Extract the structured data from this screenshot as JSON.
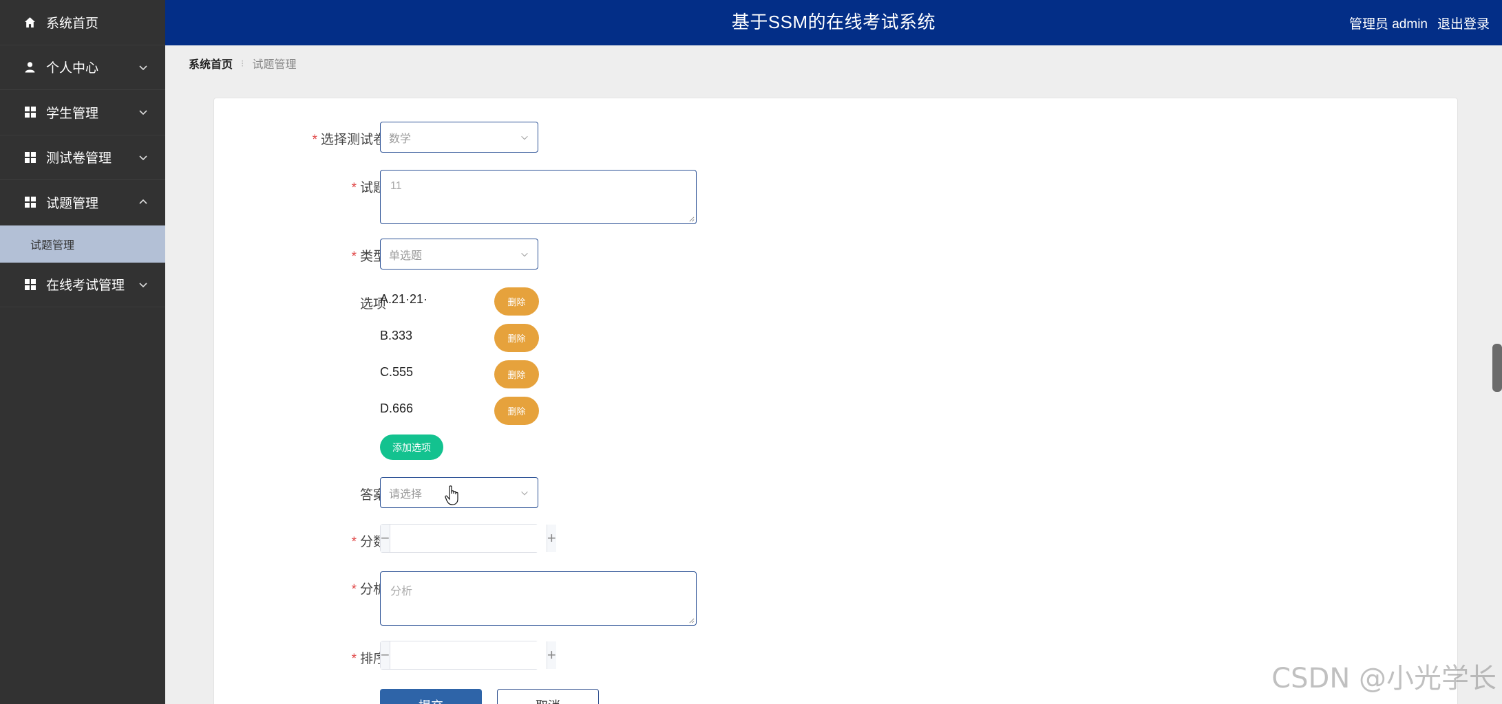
{
  "header": {
    "title": "基于SSM的在线考试系统",
    "admin_label": "管理员 admin",
    "logout_label": "退出登录"
  },
  "sidebar": {
    "items": [
      {
        "label": "系统首页",
        "icon": "home-icon"
      },
      {
        "label": "个人中心",
        "icon": "user-icon"
      },
      {
        "label": "学生管理",
        "icon": "grid-icon"
      },
      {
        "label": "测试卷管理",
        "icon": "grid-icon"
      },
      {
        "label": "试题管理",
        "icon": "grid-icon",
        "expanded": true
      },
      {
        "label": "在线考试管理",
        "icon": "grid-icon"
      }
    ],
    "sub_item": {
      "label": "试题管理",
      "active": true
    }
  },
  "breadcrumb": {
    "home": "系统首页",
    "separator": "⁝",
    "current": "试题管理"
  },
  "form": {
    "paper": {
      "label": "选择测试卷",
      "value": "数学"
    },
    "question": {
      "label": "试题",
      "value": "11"
    },
    "type": {
      "label": "类型",
      "value": "单选题"
    },
    "options": {
      "label": "选项",
      "items": [
        "A.21·21·",
        "B.333",
        "C.555",
        "D.666"
      ],
      "delete_label": "删除",
      "add_label": "添加选项"
    },
    "answer": {
      "label": "答案",
      "placeholder": "请选择"
    },
    "score": {
      "label": "分数",
      "value": ""
    },
    "analysis": {
      "label": "分析",
      "placeholder": "分析"
    },
    "order": {
      "label": "排序",
      "value": ""
    },
    "submit_label": "提交",
    "cancel_label": "取消"
  },
  "watermark": "CSDN @小光学长",
  "colors": {
    "header_bg": "#032e87",
    "sidebar_bg": "#323232",
    "sidebar_active_sub": "#b3c0d6",
    "delete_button": "#e6a23c",
    "add_button": "#13c28f",
    "submit_button": "#2e64a8"
  }
}
